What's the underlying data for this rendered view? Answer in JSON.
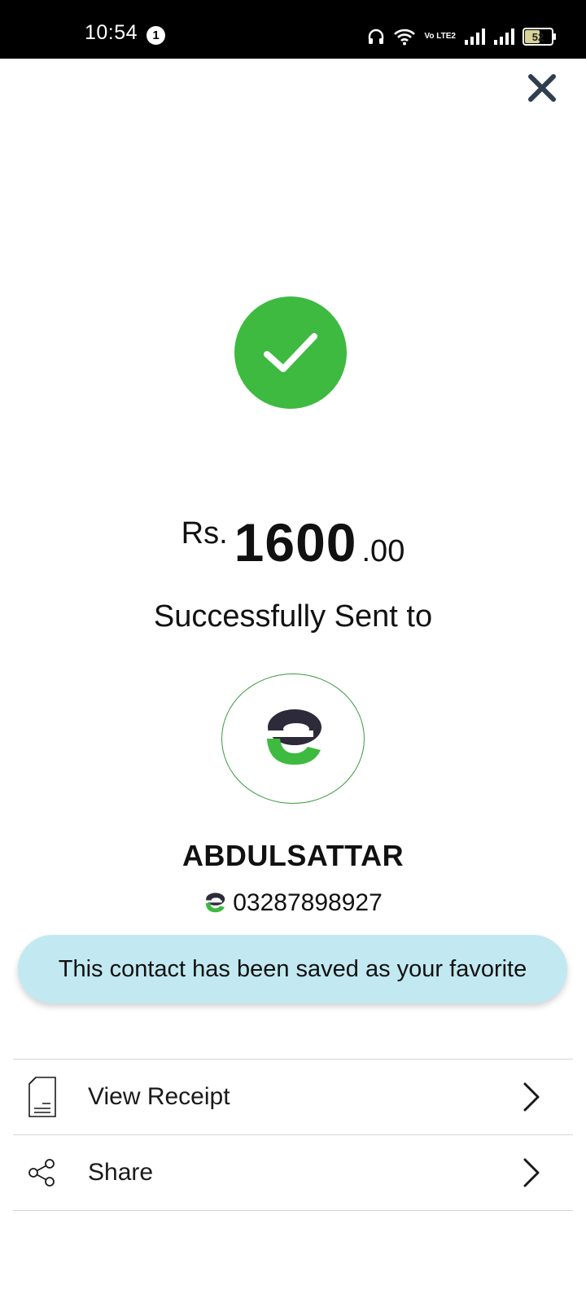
{
  "status_bar": {
    "time": "10:54",
    "notification_count": "1",
    "battery_level": "52",
    "network_label": "Vo LTE2",
    "icons": [
      "headset-icon",
      "wifi-icon",
      "volte-icon",
      "signal-icon",
      "signal-icon",
      "battery-icon"
    ]
  },
  "header": {
    "close_icon": "close-icon"
  },
  "success": {
    "icon": "checkmark-icon",
    "color": "#3dba3f"
  },
  "amount": {
    "currency": "Rs.",
    "value": "1600",
    "decimals": ".00"
  },
  "message": "Successfully Sent to",
  "recipient": {
    "name": "ABDULSATTAR",
    "number": "03287898927",
    "logo_icon": "easypaisa-logo-icon"
  },
  "toast": {
    "text": "This contact has been saved as your favorite",
    "background": "#c2e9f1"
  },
  "actions": [
    {
      "label": "View Receipt",
      "icon": "receipt-icon"
    },
    {
      "label": "Share",
      "icon": "share-icon"
    }
  ],
  "colors": {
    "brand_green": "#3dba3f",
    "brand_dark": "#2d2b3a",
    "close_icon": "#2f3e4e"
  }
}
